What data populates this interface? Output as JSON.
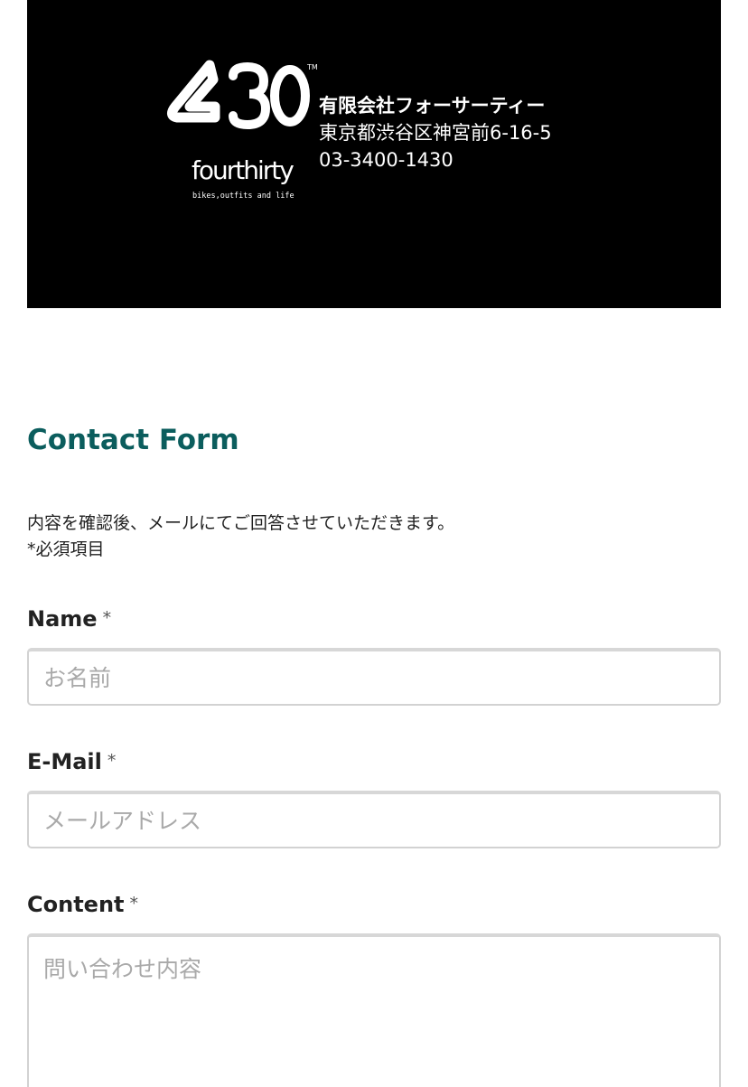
{
  "header": {
    "logo": {
      "number": "430",
      "trademark": "TM",
      "wordmark": "fourthirty",
      "tagline": "bikes,outfits and life"
    },
    "company_name": "有限会社フォーサーティー",
    "address": "東京都渋谷区神宮前6-16-5",
    "phone": "03-3400-1430"
  },
  "form": {
    "title": "Contact Form",
    "intro_line1": "内容を確認後、メールにてご回答させていただきます。",
    "intro_line2": "*必須項目",
    "required_mark": "*",
    "fields": {
      "name": {
        "label": "Name",
        "placeholder": "お名前",
        "value": ""
      },
      "email": {
        "label": "E-Mail",
        "placeholder": "メールアドレス",
        "value": ""
      },
      "content": {
        "label": "Content",
        "placeholder": "問い合わせ内容",
        "value": ""
      }
    }
  },
  "colors": {
    "title": "#0b5d5d",
    "hero_background": "#000000",
    "text": "#222222",
    "placeholder": "#a9a9a9",
    "border": "#d2d2d2"
  }
}
